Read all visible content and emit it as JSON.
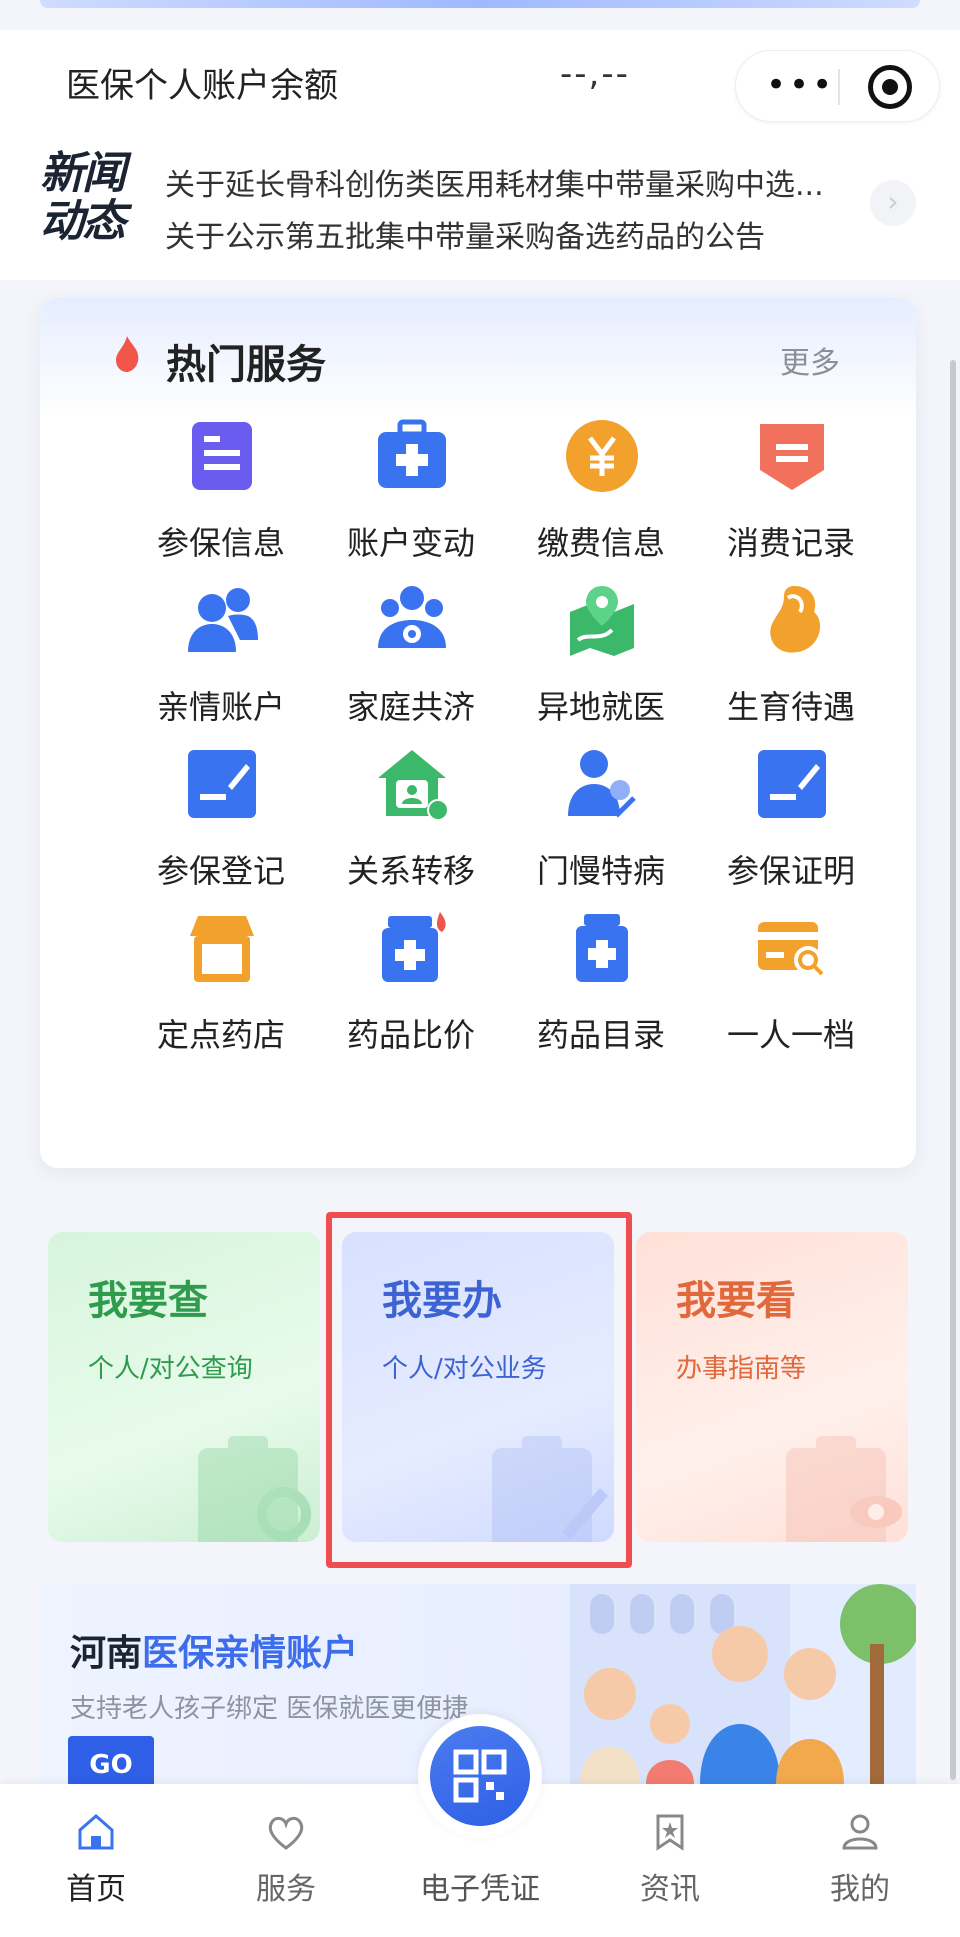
{
  "balance": {
    "label": "医保个人账户余额",
    "value": "--,--"
  },
  "news": {
    "logo_line1": "新闻",
    "logo_line2": "动态",
    "items": [
      "关于延长骨科创伤类医用耗材集中带量采购中选...",
      "关于公示第五批集中带量采购备选药品的公告"
    ]
  },
  "hot_services": {
    "title": "热门服务",
    "more": "更多",
    "items": [
      {
        "label": "参保信息",
        "icon": "document-icon",
        "color": "#6b5cf0"
      },
      {
        "label": "账户变动",
        "icon": "medkit-icon",
        "color": "#3a73f0"
      },
      {
        "label": "缴费信息",
        "icon": "yuan-icon",
        "color": "#f2a22c"
      },
      {
        "label": "消费记录",
        "icon": "receipt-icon",
        "color": "#f2715c"
      },
      {
        "label": "亲情账户",
        "icon": "people-icon",
        "color": "#3a73f0"
      },
      {
        "label": "家庭共济",
        "icon": "family-icon",
        "color": "#3a73f0"
      },
      {
        "label": "异地就医",
        "icon": "map-location-icon",
        "color": "#3cb86a"
      },
      {
        "label": "生育待遇",
        "icon": "maternity-icon",
        "color": "#f2a22c"
      },
      {
        "label": "参保登记",
        "icon": "edit-icon",
        "color": "#3a73f0"
      },
      {
        "label": "关系转移",
        "icon": "house-transfer-icon",
        "color": "#3cb86a"
      },
      {
        "label": "门慢特病",
        "icon": "doctor-check-icon",
        "color": "#3a73f0"
      },
      {
        "label": "参保证明",
        "icon": "edit-icon",
        "color": "#3a73f0"
      },
      {
        "label": "定点药店",
        "icon": "store-icon",
        "color": "#f2a22c"
      },
      {
        "label": "药品比价",
        "icon": "medicine-hot-icon",
        "color": "#3a73f0"
      },
      {
        "label": "药品目录",
        "icon": "medicine-bottle-icon",
        "color": "#3a73f0"
      },
      {
        "label": "一人一档",
        "icon": "card-search-icon",
        "color": "#f2a22c"
      }
    ]
  },
  "actions": {
    "query": {
      "title": "我要查",
      "subtitle": "个人/对公查询"
    },
    "handle": {
      "title": "我要办",
      "subtitle": "个人/对公业务"
    },
    "view": {
      "title": "我要看",
      "subtitle": "办事指南等"
    }
  },
  "banner": {
    "title_prefix": "河南",
    "title_accent": "医保亲情账户",
    "subtitle": "支持老人孩子绑定 医保就医更便捷",
    "go": "GO"
  },
  "tabbar": {
    "home": "首页",
    "service": "服务",
    "certificate": "电子凭证",
    "news": "资讯",
    "mine": "我的"
  }
}
